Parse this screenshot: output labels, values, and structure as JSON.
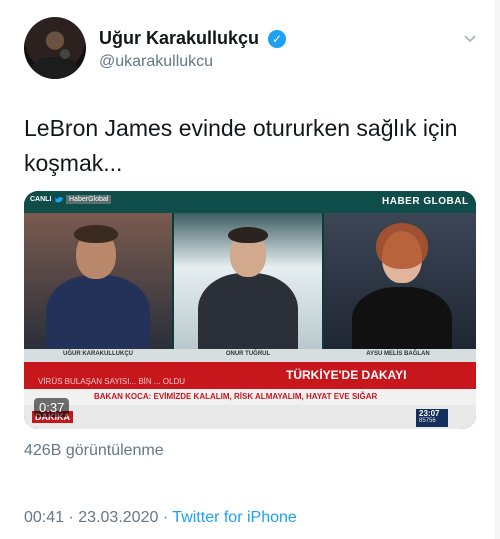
{
  "author": {
    "display_name": "Uğur Karakullukçu",
    "handle": "@ukarakullukcu",
    "verified_badge": "✓"
  },
  "tweet": {
    "text": "LeBron James evinde otururken sağlık için koşmak..."
  },
  "video": {
    "live_label": "CANLI",
    "channel_tag": "HaberGlobal",
    "brand": "HABER GLOBAL",
    "captions": [
      "UĞUR KARAKULLUKÇU",
      "ONUR TUĞRUL",
      "AYSU MELİS BAĞLAN"
    ],
    "ticker_main": "TÜRKİYE'DE DAKAYI",
    "ticker_blur": "VİRÜS BULAŞAN SAYISI... BİN ... OLDU",
    "ticker_secondary": "BAKAN KOCA: EVİMİZDE KALALIM, RİSK ALMAYALIM, HAYAT EVE SIĞAR",
    "dakika_label": "DAKİKA",
    "clock": "23:07",
    "index": "85756",
    "timecode": "0:37",
    "colors": {
      "brand_bg": "#0f4d4b",
      "ticker_red": "#c8161d"
    }
  },
  "stats": {
    "views": "426B görüntülenme"
  },
  "meta": {
    "time": "00:41",
    "date": "23.03.2020",
    "source": "Twitter for iPhone",
    "separator": "·"
  },
  "icons": {
    "verified": "verified-badge-icon",
    "more": "chevron-down-icon",
    "bird": "twitter-bird-icon"
  },
  "colors": {
    "accent": "#1da1f2",
    "muted": "#657786",
    "text": "#14171a"
  }
}
